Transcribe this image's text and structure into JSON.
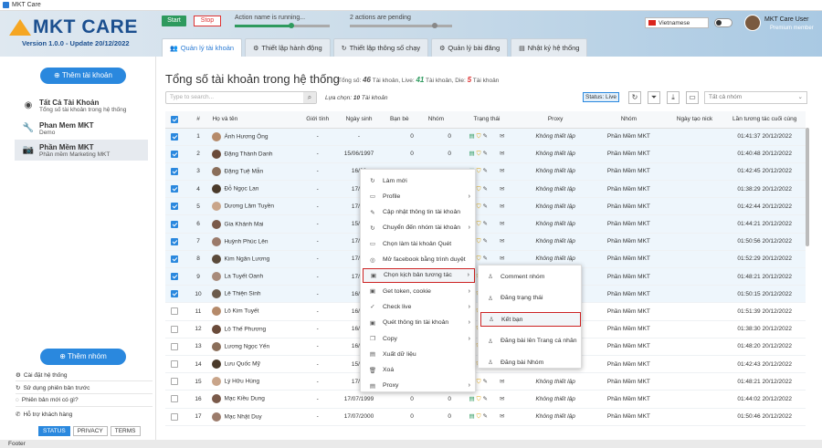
{
  "window": {
    "title": "MKT Care"
  },
  "brand": {
    "name": "MKT CARE",
    "version": "Version 1.0.0 - Update 20/12/2022"
  },
  "controls": {
    "start_label": "Start",
    "stop_label": "Stop",
    "action_status": "Action name is running...",
    "pending_status": "2 actions are pending"
  },
  "language": {
    "label": "Vietnamese"
  },
  "user": {
    "name": "MKT Care User",
    "role": "Premium member"
  },
  "tabs": [
    {
      "label": "Quản lý tài khoản",
      "icon": "users-icon"
    },
    {
      "label": "Thiết lập hành động",
      "icon": "gear-icon"
    },
    {
      "label": "Thiết lập thông số chạy",
      "icon": "refresh-icon"
    },
    {
      "label": "Quản lý bài đăng",
      "icon": "gear-icon"
    },
    {
      "label": "Nhật ký hệ thống",
      "icon": "log-icon"
    }
  ],
  "sidebar": {
    "add_account": "Thêm tài khoản",
    "accounts": [
      {
        "title": "Tất Cả Tài Khoản",
        "sub": "Tổng số tài khoản trong hệ thống"
      },
      {
        "title": "Phan Mem MKT",
        "sub": "Demo"
      },
      {
        "title": "Phần Mềm MKT",
        "sub": "Phần mềm Marketing MKT"
      }
    ],
    "add_group": "Thêm nhóm",
    "links": [
      "Cài đặt hệ thống",
      "Sử dụng phiên bản trước",
      "Phiên bản mới có gì?",
      "Hỗ trợ khách hàng"
    ],
    "footer_tabs": [
      "STATUS",
      "PRIVACY",
      "TERMS"
    ]
  },
  "main": {
    "title": "Tổng số tài khoản trong hệ thống",
    "total_label": "Tổng số:",
    "total": "46",
    "total_unit": "Tài khoản,",
    "live_label": "Live:",
    "live": "41",
    "live_unit": "Tài khoản,",
    "die_label": "Die:",
    "die": "5",
    "die_unit": "Tài khoản",
    "search_placeholder": "Type to search...",
    "selected_label": "Lựa chọn:",
    "selected": "10",
    "selected_unit": "Tài khoản",
    "status_filter": "Status: Live",
    "group_placeholder": "Tất cả nhóm"
  },
  "table": {
    "headers": [
      "#",
      "Họ và tên",
      "Giới tính",
      "Ngày sinh",
      "Bạn bè",
      "Nhóm",
      "Trạng thái",
      "Proxy",
      "Nhóm",
      "Ngày tạo nick",
      "Lần tương tác cuối cùng"
    ],
    "proxy_text": "Không thiết lập",
    "group_text": "Phần Mềm MKT",
    "rows": [
      {
        "n": "1",
        "name": "Ánh Hương Ông",
        "gender": "-",
        "dob": "-",
        "friends": "0",
        "groups": "0",
        "checked": true,
        "last": "01:41:37 20/12/2022"
      },
      {
        "n": "2",
        "name": "Đặng Thành Danh",
        "gender": "-",
        "dob": "15/06/1997",
        "friends": "0",
        "groups": "0",
        "checked": true,
        "last": "01:40:48 20/12/2022"
      },
      {
        "n": "3",
        "name": "Đặng Tuệ Mẫn",
        "gender": "-",
        "dob": "16/06",
        "friends": "",
        "groups": "",
        "checked": true,
        "last": "01:42:45 20/12/2022"
      },
      {
        "n": "4",
        "name": "Đỗ Ngọc Lan",
        "gender": "-",
        "dob": "17/06",
        "friends": "",
        "groups": "",
        "checked": true,
        "last": "01:38:29 20/12/2022"
      },
      {
        "n": "5",
        "name": "Dương Lâm Tuyền",
        "gender": "-",
        "dob": "17/06",
        "friends": "",
        "groups": "",
        "checked": true,
        "last": "01:42:44 20/12/2022"
      },
      {
        "n": "6",
        "name": "Gia Khánh Mai",
        "gender": "-",
        "dob": "15/06",
        "friends": "",
        "groups": "",
        "checked": true,
        "last": "01:44:21 20/12/2022"
      },
      {
        "n": "7",
        "name": "Huỳnh Phúc Lên",
        "gender": "-",
        "dob": "17/06",
        "friends": "",
        "groups": "",
        "checked": true,
        "last": "01:50:56 20/12/2022"
      },
      {
        "n": "8",
        "name": "Kim Ngân Lương",
        "gender": "-",
        "dob": "17/07",
        "friends": "",
        "groups": "",
        "checked": true,
        "last": "01:52:29 20/12/2022"
      },
      {
        "n": "9",
        "name": "La Tuyết Oanh",
        "gender": "-",
        "dob": "17/06",
        "friends": "",
        "groups": "",
        "checked": true,
        "last": "01:48:21 20/12/2022"
      },
      {
        "n": "10",
        "name": "Lê Thiện Sinh",
        "gender": "-",
        "dob": "16/06",
        "friends": "",
        "groups": "",
        "checked": true,
        "last": "01:50:15 20/12/2022"
      },
      {
        "n": "11",
        "name": "Lô Kim Tuyết",
        "gender": "-",
        "dob": "16/06",
        "friends": "",
        "groups": "",
        "checked": false,
        "last": "01:51:39 20/12/2022"
      },
      {
        "n": "12",
        "name": "Lô Thế Phương",
        "gender": "-",
        "dob": "16/06",
        "friends": "",
        "groups": "",
        "checked": false,
        "last": "01:38:30 20/12/2022"
      },
      {
        "n": "13",
        "name": "Lương Ngọc Yến",
        "gender": "-",
        "dob": "16/06",
        "friends": "",
        "groups": "",
        "checked": false,
        "last": "01:48:20 20/12/2022"
      },
      {
        "n": "14",
        "name": "Lưu Quốc Mỹ",
        "gender": "-",
        "dob": "15/06",
        "friends": "",
        "groups": "",
        "checked": false,
        "last": "01:42:43 20/12/2022"
      },
      {
        "n": "15",
        "name": "Lý Hữu Hùng",
        "gender": "-",
        "dob": "17/06",
        "friends": "",
        "groups": "",
        "checked": false,
        "last": "01:48:21 20/12/2022"
      },
      {
        "n": "16",
        "name": "Mạc Kiều Dung",
        "gender": "-",
        "dob": "17/07/1999",
        "friends": "0",
        "groups": "0",
        "checked": false,
        "last": "01:44:02 20/12/2022"
      },
      {
        "n": "17",
        "name": "Mạc Nhật Duy",
        "gender": "-",
        "dob": "17/07/2000",
        "friends": "0",
        "groups": "0",
        "checked": false,
        "last": "01:50:46 20/12/2022"
      }
    ]
  },
  "context_menu": [
    {
      "label": "Làm mới",
      "icon": "refresh-icon",
      "arrow": false
    },
    {
      "label": "Profile",
      "icon": "user-icon",
      "arrow": true
    },
    {
      "label": "Cập nhật thông tin tài khoản",
      "icon": "edit-icon",
      "arrow": false
    },
    {
      "label": "Chuyển đến nhóm tài khoản",
      "icon": "move-icon",
      "arrow": true
    },
    {
      "label": "Chọn làm tài khoản Quét",
      "icon": "scan-icon",
      "arrow": false
    },
    {
      "label": "Mở facebook bằng trình duyệt",
      "icon": "browser-icon",
      "arrow": false
    },
    {
      "label": "Chọn kịch bản tương tác",
      "icon": "script-icon",
      "arrow": true,
      "selected": true
    },
    {
      "label": "Get token, cookie",
      "icon": "key-icon",
      "arrow": true
    },
    {
      "label": "Check live",
      "icon": "check-icon",
      "arrow": true
    },
    {
      "label": "Quét thông tin tài khoản",
      "icon": "search-icon",
      "arrow": true
    },
    {
      "label": "Copy",
      "icon": "copy-icon",
      "arrow": true
    },
    {
      "label": "Xuất dữ liệu",
      "icon": "export-icon",
      "arrow": false
    },
    {
      "label": "Xoá",
      "icon": "trash-icon",
      "arrow": false
    },
    {
      "label": "Proxy",
      "icon": "proxy-icon",
      "arrow": true
    }
  ],
  "submenu": [
    {
      "label": "Comment nhóm"
    },
    {
      "label": "Đăng trạng thái"
    },
    {
      "label": "Kết bạn",
      "selected": true
    },
    {
      "label": "Đăng bài lên Trang cá nhân"
    },
    {
      "label": "Đăng bài Nhóm"
    }
  ],
  "footer": {
    "label": "Footer"
  },
  "colors": {
    "accent": "#2a88de",
    "live": "#2e9a5e",
    "die": "#d33333",
    "selected_border": "#cc2222"
  }
}
